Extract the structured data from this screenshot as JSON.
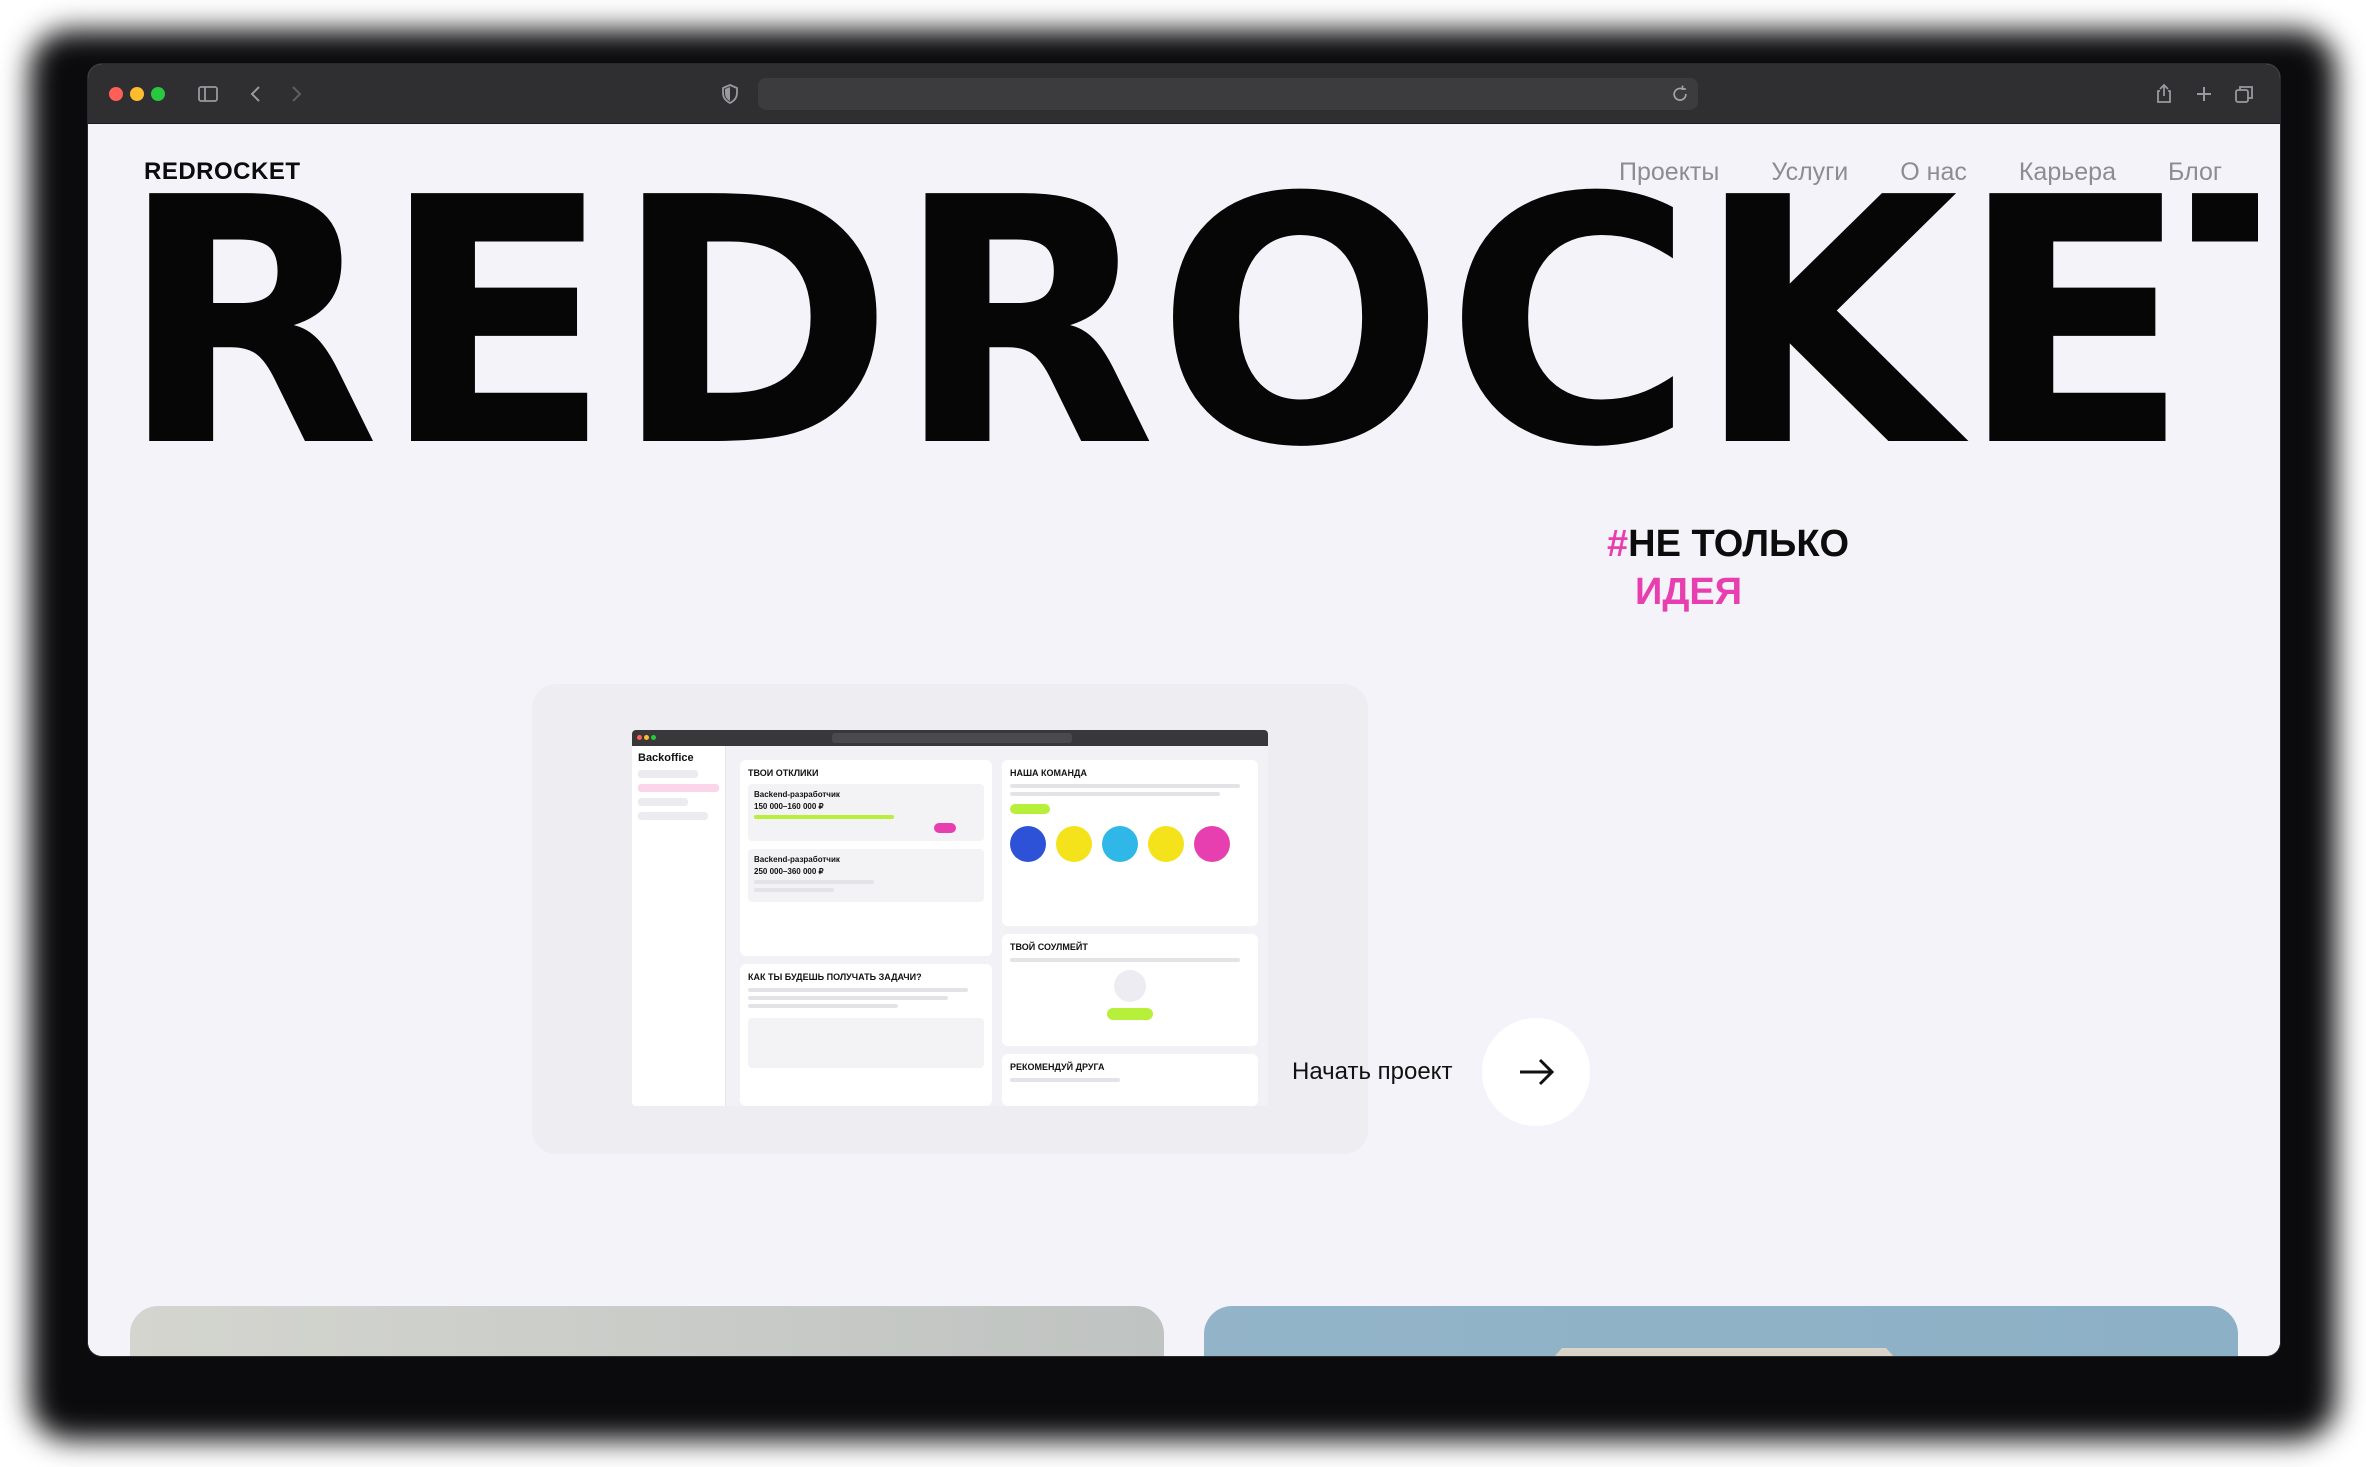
{
  "browser": {
    "address": ""
  },
  "header": {
    "logo": "REDROCKET",
    "nav": [
      "Проекты",
      "Услуги",
      "О нас",
      "Карьера",
      "Блог"
    ]
  },
  "hero": {
    "title": "REDROCKET",
    "tagline": {
      "hash": "#",
      "line1": "НЕ ТОЛЬКО",
      "line2": "ИДЕЯ"
    }
  },
  "showcase": {
    "mock": {
      "brand": "Backoffice",
      "panels": {
        "responses": "ТВОИ ОТКЛИКИ",
        "team": "НАША КОМАНДА",
        "tasks": "КАК ТЫ БУДЕШЬ ПОЛУЧАТЬ ЗАДАЧИ?",
        "soulmate": "ТВОЙ СОУЛМЕЙТ",
        "recommend": "РЕКОМЕНДУЙ ДРУГА"
      },
      "jobs": [
        {
          "title": "Backend-разработчик",
          "salary": "150 000–160 000 ₽"
        },
        {
          "title": "Backend-разработчик",
          "salary": "250 000–360 000 ₽"
        }
      ]
    },
    "cta": {
      "label": "Начать проект"
    }
  },
  "colors": {
    "accent": "#e83fb0",
    "background": "#f4f3fa",
    "text": "#060606"
  },
  "icons": {
    "sidebar": "sidebar-icon",
    "back": "chevron-left-icon",
    "forward": "chevron-right-icon",
    "shield": "shield-icon",
    "reload": "reload-icon",
    "share": "share-icon",
    "new_tab": "plus-icon",
    "tabs": "tabs-icon",
    "arrow": "arrow-right-icon"
  }
}
